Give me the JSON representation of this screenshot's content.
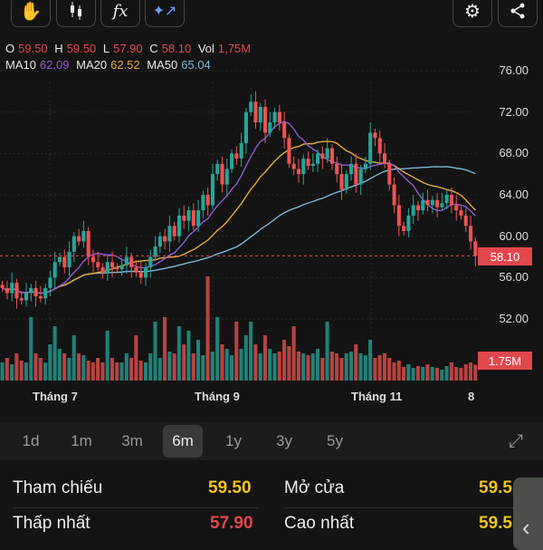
{
  "toolbar": {
    "left": [
      "hand-tool",
      "candle-type",
      "indicators-fx",
      "ai-analysis"
    ],
    "right": [
      "settings",
      "share"
    ],
    "fx_label": "fx"
  },
  "ohlc": {
    "o_label": "O",
    "o": "59.50",
    "h_label": "H",
    "h": "59.50",
    "l_label": "L",
    "l": "57.90",
    "c_label": "C",
    "c": "58.10",
    "vol_label": "Vol",
    "vol": "1,75M"
  },
  "ma": {
    "ma10_label": "MA10",
    "ma10": "62.09",
    "ma20_label": "MA20",
    "ma20": "62.52",
    "ma50_label": "MA50",
    "ma50": "65.04"
  },
  "colors": {
    "up": "#26a69a",
    "down": "#ef5350",
    "ma10": "#8e5bd6",
    "ma20": "#e5a93a",
    "ma50": "#7ab7d8",
    "gold": "#f0c419",
    "red": "#e0484d"
  },
  "price_axis": [
    "76.00",
    "72.00",
    "68.00",
    "64.00",
    "60.00",
    "56.00",
    "52.00"
  ],
  "current_price": "58.10",
  "current_volume": "1.75M",
  "x_labels": [
    "Tháng 7",
    "Tháng 9",
    "Tháng 11",
    "8"
  ],
  "periods": [
    "1d",
    "1m",
    "3m",
    "6m",
    "1y",
    "3y",
    "5y"
  ],
  "active_period": "6m",
  "stats": [
    {
      "label": "Tham chiếu",
      "value": "59.50"
    },
    {
      "label": "Thấp nhất",
      "value": "57.90"
    },
    {
      "label": "Mở cửa",
      "value": "59.5"
    },
    {
      "label": "Cao nhất",
      "value": "59.5"
    }
  ],
  "chart_data": {
    "type": "candlestick",
    "ylim": [
      50,
      78
    ],
    "closes": [
      55,
      54.5,
      55.5,
      54,
      53.8,
      54.5,
      55,
      54.2,
      54,
      55,
      56,
      57.5,
      58,
      57,
      58.5,
      60,
      59.5,
      60.5,
      58,
      57.5,
      57,
      56.5,
      57.5,
      57,
      56.8,
      57.2,
      58,
      57,
      56.5,
      56,
      57,
      58,
      59,
      60,
      59.5,
      61,
      60,
      62,
      61.5,
      62.5,
      61,
      62.5,
      64,
      63,
      66,
      67,
      65,
      66.5,
      68,
      67.5,
      69,
      72,
      73,
      71,
      72.5,
      70,
      71,
      72,
      71,
      69.5,
      67,
      66.5,
      66,
      67.5,
      66.8,
      67,
      68,
      67.5,
      68.5,
      67,
      66,
      64.5,
      66,
      67,
      65,
      66.5,
      67,
      70,
      69.5,
      68,
      67,
      65,
      63,
      61,
      60.5,
      62,
      63,
      62.5,
      63.5,
      63,
      63.5,
      62.8,
      63.2,
      64,
      63,
      62.5,
      62,
      61,
      59.5,
      58.1
    ],
    "volumes": [
      2,
      2.5,
      1.8,
      3,
      2.2,
      2,
      7,
      3,
      2.5,
      2,
      4,
      6,
      3.5,
      3,
      2.5,
      5,
      3,
      2.8,
      2.2,
      2,
      2.5,
      2,
      5.5,
      2.5,
      2,
      2,
      3,
      2.5,
      5,
      2.2,
      2,
      3,
      6.5,
      2.5,
      7,
      3.2,
      3,
      6,
      4,
      5.5,
      3,
      4.5,
      2.8,
      11.5,
      3.2,
      7,
      4,
      3.5,
      2.8,
      6.5,
      3.5,
      5,
      6.5,
      4,
      3,
      5,
      3.5,
      3,
      3.2,
      4.5,
      3.8,
      6,
      3.2,
      3,
      2.8,
      3,
      3.5,
      2.5,
      6.5,
      3.2,
      3,
      2.5,
      3,
      3.2,
      4,
      3,
      2.8,
      4.5,
      2.5,
      2.8,
      3,
      2.5,
      2,
      2.2,
      1.5,
      1.8,
      1.4,
      1.6,
      1.5,
      1.8,
      1.5,
      1.4,
      1.2,
      1.6,
      2,
      1.5,
      1.4,
      1.8,
      2,
      1.75
    ]
  }
}
